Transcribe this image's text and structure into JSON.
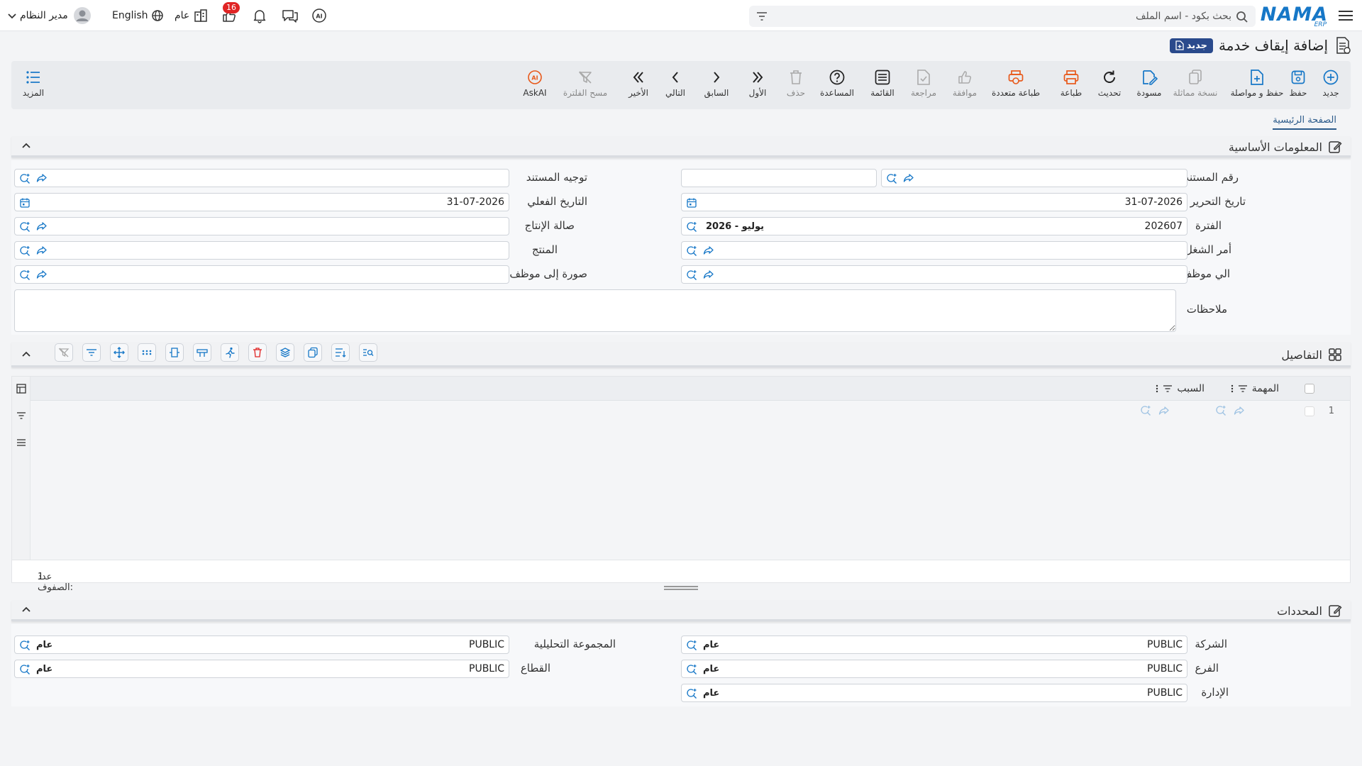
{
  "topbar": {
    "logo": "NAMA",
    "logo_sub": "ERP",
    "search_placeholder": "بحث بكود - اسم الملف",
    "notification_count": "16",
    "scope_label": "عام",
    "language_label": "English",
    "user_name": "مدير النظام"
  },
  "page": {
    "title": "إضافة إيقاف خدمة",
    "status_badge": "جديد"
  },
  "toolbar": {
    "new": "جديد",
    "save": "حفظ",
    "save_continue": "حفظ و مواصلة",
    "duplicate": "نسخة مماثلة",
    "draft": "مسودة",
    "refresh": "تحديث",
    "print": "طباعة",
    "multi_print": "طباعة متعددة",
    "approve": "موافقة",
    "review": "مراجعة",
    "list": "القائمة",
    "help": "المساعدة",
    "delete": "حذف",
    "first": "الأول",
    "previous": "السابق",
    "next": "التالي",
    "last": "الأخير",
    "clear_filter": "مسح الفلترة",
    "ask_ai": "AskAI",
    "more": "المزيد"
  },
  "tabs": {
    "main": "الصفحة الرئيسية"
  },
  "basic_info": {
    "title": "المعلومات الأساسية",
    "doc_number_label": "رقم المستند",
    "doc_number_value": "",
    "doc_direction_label": "توجيه المستند",
    "doc_direction_value": "",
    "edit_date_label": "تاريخ التحرير",
    "edit_date_value": "31-07-2026",
    "actual_date_label": "التاريخ الفعلي",
    "actual_date_value": "31-07-2026",
    "period_label": "الفترة",
    "period_value": "202607",
    "period_tag": "2026 - يوليو",
    "production_hall_label": "صالة الإنتاج",
    "work_order_label": "أمر الشغل",
    "product_label": "المنتج",
    "to_employee_label": "الي موظف",
    "copy_to_employee_label": "صورة إلى موظف",
    "notes_label": "ملاحظات"
  },
  "details": {
    "title": "التفاصيل",
    "col_task": "المهمة",
    "col_reason": "السبب",
    "row_number": "1",
    "rows_count_label": "عدد الصفوف:",
    "rows_count": "1"
  },
  "dimensions": {
    "title": "المحددات",
    "company_label": "الشركة",
    "company_value": "PUBLIC",
    "company_tag": "عام",
    "analytic_group_label": "المجموعة التحليلية",
    "analytic_group_value": "PUBLIC",
    "analytic_group_tag": "عام",
    "branch_label": "الفرع",
    "branch_value": "PUBLIC",
    "branch_tag": "عام",
    "sector_label": "القطاع",
    "sector_value": "PUBLIC",
    "sector_tag": "عام",
    "department_label": "الإدارة",
    "department_value": "PUBLIC",
    "department_tag": "عام"
  },
  "colors": {
    "brand": "#1677c7",
    "badge_bg": "#2a4a8c",
    "print_orange": "#e8591a",
    "tool_blue": "#1677c7",
    "notification_red": "#e02424"
  }
}
